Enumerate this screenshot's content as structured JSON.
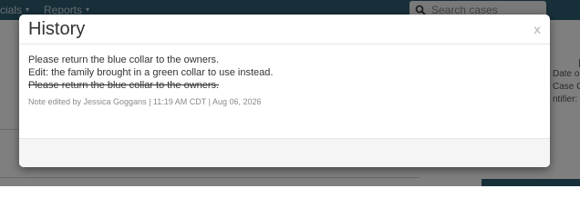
{
  "navbar": {
    "items": [
      {
        "label": "cials"
      },
      {
        "label": "Reports"
      }
    ],
    "search_placeholder": "Search cases"
  },
  "right_panel": {
    "letter": "F",
    "date_label": "Date o",
    "case_label": "Case C",
    "identifier_label": "ntifier: F"
  },
  "modal": {
    "title": "History",
    "close_label": "x",
    "notes": [
      {
        "text": "Please return the blue collar to the owners.",
        "struck": false
      },
      {
        "text": "Edit: the family brought in a green collar to use instead.",
        "struck": false
      },
      {
        "text": "Please return the blue collar to the owners.",
        "struck": true
      }
    ],
    "meta": "Note edited by Jessica Goggans | 11:19 AM CDT | Aug 06, 2026"
  },
  "colors": {
    "navbar": "#2f5e73",
    "overlay": "rgba(0,0,0,0.5)"
  }
}
